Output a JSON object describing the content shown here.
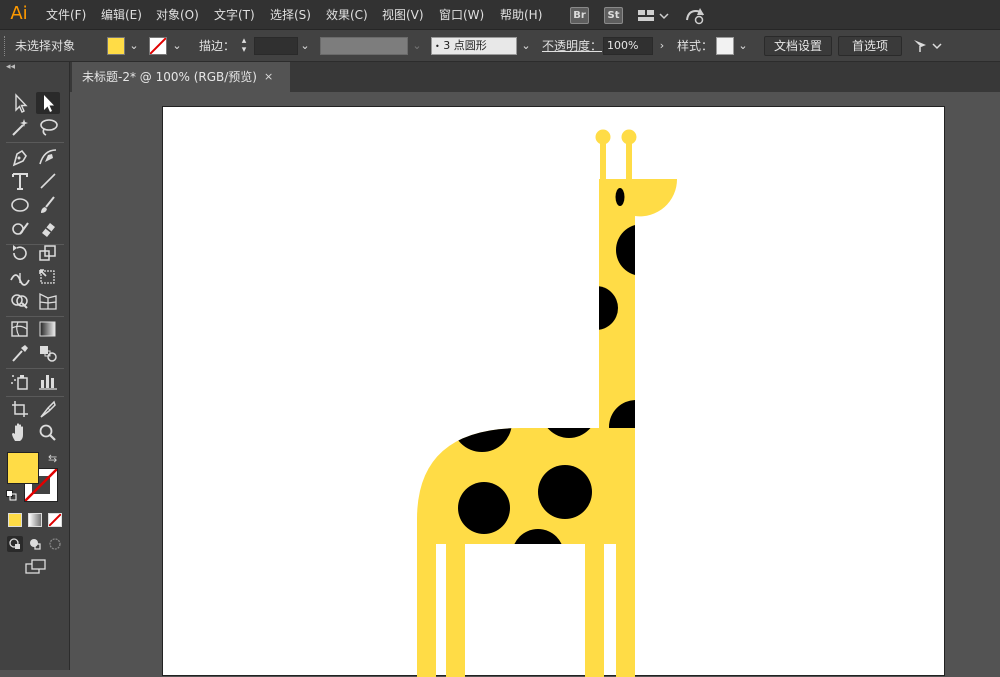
{
  "app": {
    "logo": "Ai"
  },
  "menu": [
    "文件(F)",
    "编辑(E)",
    "对象(O)",
    "文字(T)",
    "选择(S)",
    "效果(C)",
    "视图(V)",
    "窗口(W)",
    "帮助(H)"
  ],
  "menubar_icons": {
    "bridge": "Br",
    "stock": "St",
    "workspace": "layout-icon",
    "sync": "sync-icon"
  },
  "controlbar": {
    "selection_status": "未选择对象",
    "fill_color": "#ffdc46",
    "stroke_label": "描边：",
    "brush_label": "3 点圆形",
    "opacity_label": "不透明度：",
    "opacity_value": "100%",
    "style_label": "样式：",
    "doc_setup_button": "文档设置",
    "preferences_button": "首选项"
  },
  "tabs": [
    {
      "label": "未标题-2* @ 100% (RGB/预览)",
      "close": "×"
    }
  ],
  "toolbar": {
    "collapse": "◂◂",
    "fill_color": "#ffdc46",
    "stroke_color": "none"
  },
  "artwork": {
    "body_color": "#ffdc46",
    "spot_color": "#000000",
    "background": "#ffffff"
  }
}
